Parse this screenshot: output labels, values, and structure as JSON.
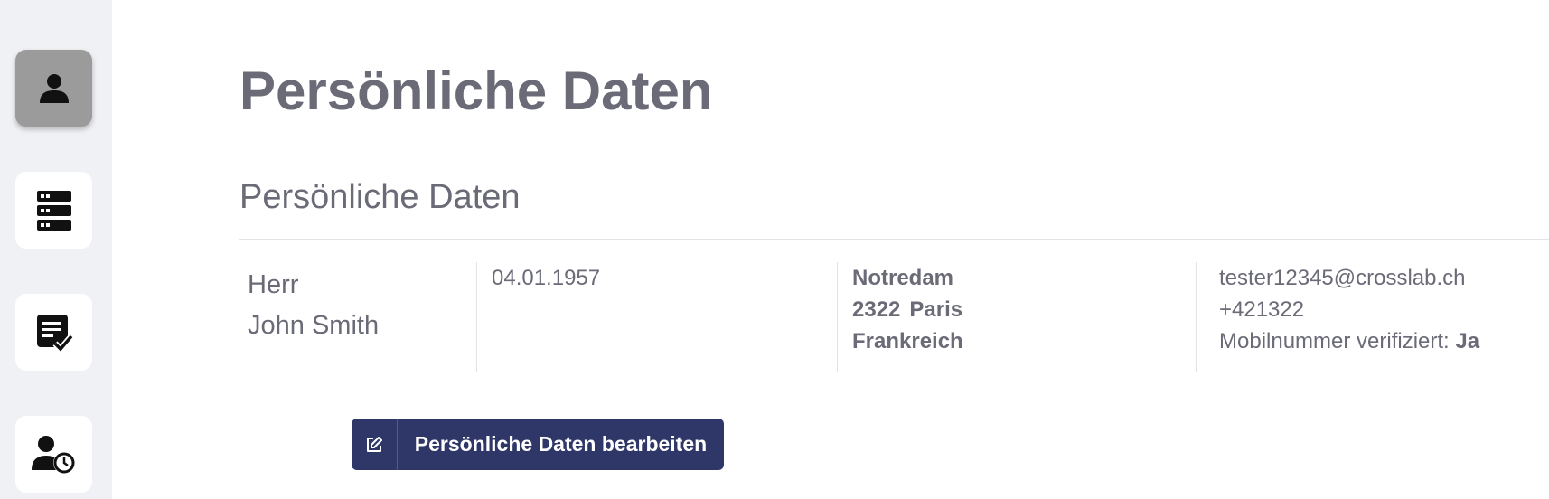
{
  "sidebar": {
    "items": [
      {
        "icon": "person-icon",
        "active": true
      },
      {
        "icon": "server-stack-icon",
        "active": false
      },
      {
        "icon": "document-check-icon",
        "active": false
      },
      {
        "icon": "user-clock-icon",
        "active": false
      }
    ]
  },
  "page": {
    "title": "Persönliche Daten",
    "section_title": "Persönliche Daten"
  },
  "person": {
    "salutation": "Herr",
    "name": "John Smith",
    "birthdate": "04.01.1957",
    "street": "Notredam",
    "zip": "2322",
    "city": "Paris",
    "country": "Frankreich",
    "email": "tester12345@crosslab.ch",
    "phone": "+421322",
    "mobile_verified_label": "Mobilnummer verifiziert:",
    "mobile_verified_value": "Ja"
  },
  "actions": {
    "edit_label": "Persönliche Daten bearbeiten"
  },
  "colors": {
    "text": "#6a6b77",
    "primary_button": "#2f3768",
    "sidebar_bg": "#f0f1f4",
    "active_nav": "#9b9b9b"
  }
}
